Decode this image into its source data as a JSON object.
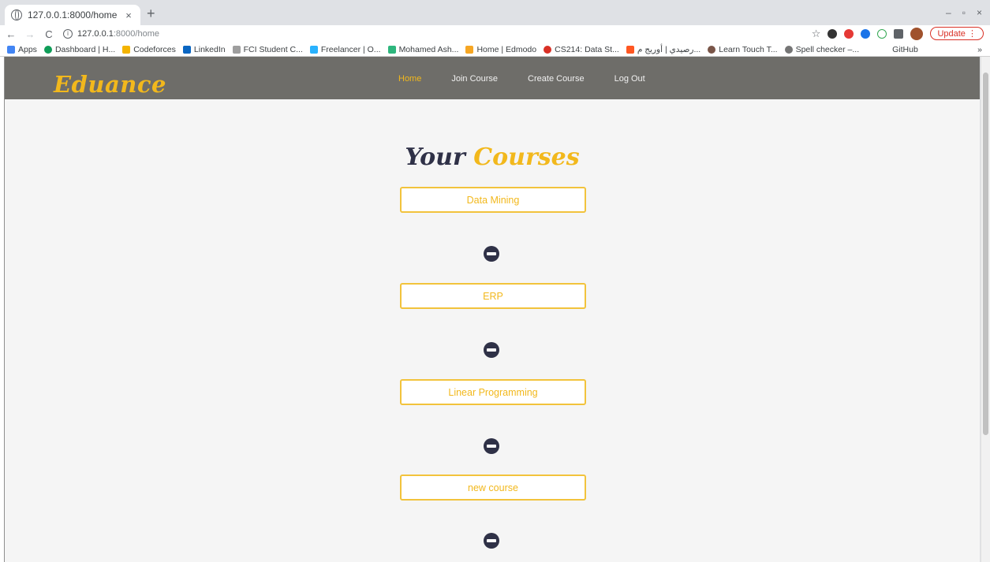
{
  "browser": {
    "tab_title": "127.0.0.1:8000/home",
    "tab_close": "×",
    "new_tab": "+",
    "url_host": "127.0.0.1",
    "url_rest": ":8000/home",
    "update_label": "Update",
    "window_controls": [
      "–",
      "▫",
      "×"
    ]
  },
  "bookmarks": [
    {
      "label": "Apps",
      "color": "#4285f4"
    },
    {
      "label": "Dashboard | H...",
      "color": "#0f9d58"
    },
    {
      "label": "Codeforces",
      "color": "#f4b400"
    },
    {
      "label": "LinkedIn",
      "color": "#0a66c2"
    },
    {
      "label": "FCI Student C...",
      "color": "#9e9e9e"
    },
    {
      "label": "Freelancer | O...",
      "color": "#29b2fe"
    },
    {
      "label": "Mohamed Ash...",
      "color": "#2eb67d"
    },
    {
      "label": "Home | Edmodo",
      "color": "#f6a623"
    },
    {
      "label": "CS214: Data St...",
      "color": "#d93025"
    },
    {
      "label": "رصيدي | أوريج م...",
      "color": "#ff5722"
    },
    {
      "label": "Learn Touch T...",
      "color": "#795548"
    },
    {
      "label": "Spell checker –...",
      "color": "#757575"
    },
    {
      "label": "GitHub",
      "color": "#ffffff"
    }
  ],
  "bookmarks_more": "»",
  "site": {
    "brand": "Eduance",
    "nav": [
      {
        "label": "Home",
        "active": true
      },
      {
        "label": "Join Course",
        "active": false
      },
      {
        "label": "Create Course",
        "active": false
      },
      {
        "label": "Log Out",
        "active": false
      }
    ],
    "heading_dark": "Your",
    "heading_gold": "Courses",
    "courses": [
      "Data Mining",
      "ERP",
      "Linear Programming",
      "new course"
    ]
  },
  "colors": {
    "gold": "#f2b81c",
    "navy": "#2f3147",
    "navbar": "#6e6d69"
  }
}
